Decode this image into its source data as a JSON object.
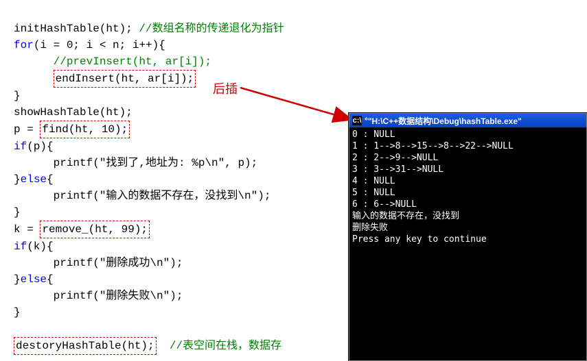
{
  "code": {
    "l1a": "initHashTable(ht);",
    "l1c": " //数组名称的传递退化为指针",
    "l2_for": "for",
    "l2b": "(i = 0; i < n; i++){",
    "l3c": "      //prevInsert(ht, ar[i]);",
    "l4box": "endInsert(ht, ar[i]);",
    "l5": "}",
    "l6": "showHashTable(ht);",
    "l7a": "p = ",
    "l7box": "find(ht, 10);",
    "l8_if": "if",
    "l8b": "(p){",
    "l9": "      printf(\"找到了,地址为: %p\\n\", p);",
    "l10": "}",
    "l10_else": "else",
    "l10b": "{",
    "l11": "      printf(\"输入的数据不存在，没找到\\n\");",
    "l12": "}",
    "l13a": "k = ",
    "l13box": "remove_(ht, 99);",
    "l14_if": "if",
    "l14b": "(k){",
    "l15": "      printf(\"删除成功\\n\");",
    "l16": "}",
    "l16_else": "else",
    "l16b": "{",
    "l17": "      printf(\"删除失败\\n\");",
    "l18": "}",
    "l20box": "destoryHashTable(ht);",
    "l20c": "  //表空间在栈，数据存"
  },
  "annotation": "后插",
  "console": {
    "title_prefix": "°",
    "title": "\"H:\\C++数据结构\\Debug\\hashTable.exe\"",
    "lines": [
      "0 : NULL",
      "1 : 1-->8-->15-->8-->22-->NULL",
      "2 : 2-->9-->NULL",
      "3 : 3-->31-->NULL",
      "4 : NULL",
      "5 : NULL",
      "6 : 6-->NULL",
      "输入的数据不存在，没找到",
      "删除失败",
      "Press any key to continue"
    ]
  }
}
